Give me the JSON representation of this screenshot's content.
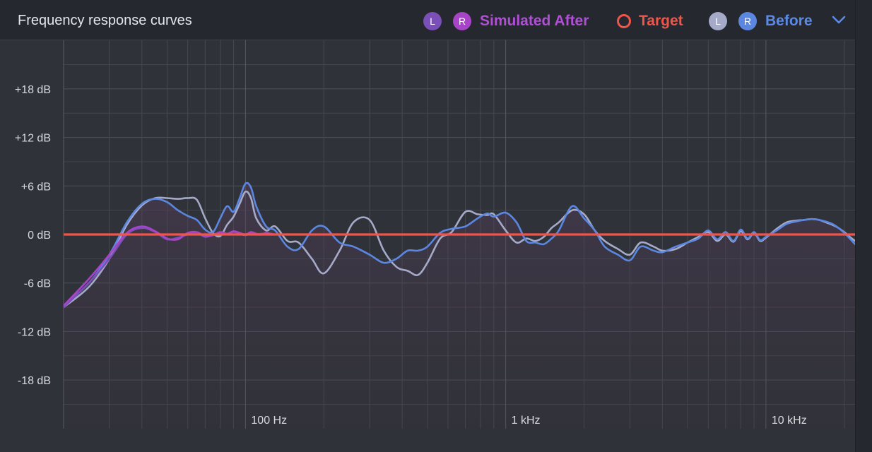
{
  "header": {
    "title": "Frequency response curves",
    "legend": {
      "after_left_badge": "L",
      "after_right_badge": "R",
      "after_label": "Simulated After",
      "target_label": "Target",
      "before_left_badge": "L",
      "before_right_badge": "R",
      "before_label": "Before"
    }
  },
  "colors": {
    "after_left": "#7b4fb8",
    "after_right": "#a844c8",
    "after_label": "#b04fd6",
    "target": "#f0554b",
    "before_left": "#a5aac8",
    "before_right": "#5b87e0",
    "before_label": "#5b8ae6"
  },
  "chart_data": {
    "type": "line",
    "x_scale": "log",
    "xlim": [
      20,
      22000
    ],
    "ylim": [
      -24,
      24
    ],
    "y_ticks": [
      18,
      12,
      6,
      0,
      -6,
      -12,
      -18
    ],
    "y_tick_labels": [
      "+18 dB",
      "+12 dB",
      "+6 dB",
      "0 dB",
      "-6 dB",
      "-12 dB",
      "-18 dB"
    ],
    "x_ticks": [
      100,
      1000,
      10000
    ],
    "x_tick_labels": [
      "100 Hz",
      "1 kHz",
      "10 kHz"
    ],
    "grid": true,
    "series": [
      {
        "name": "Target",
        "key": "target",
        "x": [
          20,
          22000
        ],
        "y": [
          0,
          0
        ]
      },
      {
        "name": "Before R",
        "key": "before_right",
        "x": [
          20,
          25,
          30,
          35,
          40,
          45,
          50,
          55,
          60,
          65,
          70,
          75,
          80,
          85,
          90,
          95,
          100,
          105,
          110,
          120,
          130,
          145,
          160,
          180,
          200,
          230,
          260,
          300,
          340,
          380,
          420,
          460,
          500,
          560,
          620,
          700,
          780,
          850,
          900,
          1000,
          1100,
          1200,
          1300,
          1400,
          1500,
          1600,
          1800,
          2000,
          2200,
          2400,
          2700,
          3000,
          3300,
          3700,
          4000,
          4500,
          5000,
          5500,
          6000,
          6500,
          7000,
          7500,
          8000,
          8500,
          9000,
          9500,
          10000,
          11000,
          12000,
          13000,
          14000,
          15000,
          16000,
          17000,
          18000,
          19000,
          20000,
          21000,
          22000
        ],
        "y": [
          -8.8,
          -6.0,
          -2.5,
          1.5,
          3.8,
          4.4,
          4.0,
          3.0,
          2.3,
          1.8,
          0.6,
          0.3,
          2.0,
          3.5,
          2.8,
          4.5,
          6.3,
          5.8,
          3.5,
          1.0,
          0.5,
          -1.5,
          -1.8,
          0.5,
          1.0,
          -1.0,
          -1.5,
          -2.5,
          -3.5,
          -3.0,
          -2.0,
          -2.0,
          -1.5,
          0.2,
          0.7,
          1.0,
          2.0,
          2.6,
          2.2,
          2.7,
          1.5,
          -0.8,
          -1.0,
          -1.2,
          -0.5,
          0.5,
          3.5,
          2.0,
          0.5,
          -1.5,
          -2.5,
          -3.2,
          -1.5,
          -2.0,
          -2.2,
          -1.5,
          -1.0,
          -0.5,
          0.5,
          -0.6,
          0.3,
          -0.8,
          0.6,
          -0.5,
          0.3,
          -0.7,
          -0.3,
          0.5,
          1.3,
          1.6,
          1.8,
          1.9,
          1.8,
          1.6,
          1.3,
          0.8,
          0.2,
          -0.5,
          -1.2
        ]
      },
      {
        "name": "Before L",
        "key": "before_left",
        "x": [
          20,
          25,
          30,
          35,
          40,
          45,
          50,
          55,
          60,
          65,
          70,
          75,
          80,
          85,
          90,
          95,
          100,
          105,
          110,
          120,
          130,
          145,
          160,
          180,
          200,
          230,
          260,
          300,
          340,
          380,
          420,
          460,
          500,
          560,
          620,
          700,
          780,
          850,
          900,
          1000,
          1100,
          1200,
          1300,
          1400,
          1500,
          1600,
          1800,
          2000,
          2200,
          2400,
          2700,
          3000,
          3300,
          3700,
          4000,
          4500,
          5000,
          5500,
          6000,
          6500,
          7000,
          7500,
          8000,
          8500,
          9000,
          9500,
          10000,
          11000,
          12000,
          13000,
          14000,
          15000,
          16000,
          17000,
          18000,
          19000,
          20000,
          21000,
          22000
        ],
        "y": [
          -9.0,
          -6.5,
          -3.0,
          1.2,
          3.6,
          4.5,
          4.5,
          4.4,
          4.5,
          4.3,
          2.0,
          0.2,
          -0.2,
          1.2,
          2.2,
          3.8,
          5.3,
          4.5,
          2.0,
          0.5,
          1.0,
          -0.8,
          -1.0,
          -3.0,
          -4.8,
          -2.0,
          1.5,
          1.8,
          -2.0,
          -4.0,
          -4.5,
          -5.0,
          -3.5,
          -0.5,
          0.3,
          2.8,
          2.5,
          2.4,
          2.5,
          0.5,
          -1.0,
          -0.5,
          -0.8,
          -0.3,
          0.8,
          1.5,
          3.0,
          2.5,
          0.5,
          -0.8,
          -1.8,
          -2.5,
          -1.0,
          -1.5,
          -2.0,
          -1.8,
          -1.0,
          -0.3,
          0.3,
          -0.8,
          0.0,
          -0.9,
          0.4,
          -0.6,
          0.2,
          -0.8,
          -0.4,
          0.7,
          1.5,
          1.7,
          1.8,
          1.9,
          1.8,
          1.5,
          1.2,
          0.8,
          0.3,
          -0.3,
          -0.8
        ]
      },
      {
        "name": "Simulated After R",
        "key": "after_right",
        "x": [
          20,
          25,
          30,
          35,
          40,
          45,
          50,
          55,
          60,
          65,
          70,
          75,
          80,
          85,
          90,
          95,
          100,
          105,
          110,
          115,
          120,
          125,
          130
        ],
        "y": [
          -8.8,
          -5.5,
          -2.5,
          0.2,
          1.0,
          0.4,
          -0.5,
          -0.6,
          0.2,
          0.3,
          -0.2,
          -0.1,
          0.3,
          0.1,
          0.4,
          0.2,
          0.0,
          0.3,
          0.1,
          0.0,
          0.2,
          0.1,
          0.0
        ]
      },
      {
        "name": "Simulated After L",
        "key": "after_left",
        "x": [
          20,
          25,
          30,
          35,
          40,
          45,
          50,
          55,
          60,
          65,
          70,
          75,
          80,
          85,
          90,
          95,
          100,
          105,
          110,
          115,
          120,
          125,
          130
        ],
        "y": [
          -9.0,
          -6.0,
          -3.0,
          0.0,
          0.8,
          0.3,
          -0.6,
          -0.4,
          0.0,
          0.2,
          -0.3,
          0.0,
          0.2,
          0.0,
          0.3,
          0.1,
          -0.1,
          0.2,
          0.0,
          0.1,
          0.1,
          0.0,
          0.0
        ]
      }
    ]
  }
}
